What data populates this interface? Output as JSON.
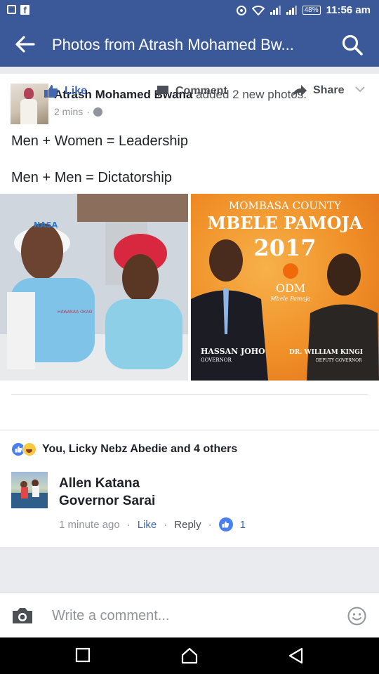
{
  "status_bar": {
    "battery": "48%",
    "time": "11:56 am"
  },
  "app_bar": {
    "title": "Photos from Atrash Mohamed Bw..."
  },
  "post": {
    "author": "Atrash Mohamed Bwana",
    "action_text": "added 2 new photos.",
    "timestamp": "2 mins",
    "text_line_1": "Men + Women = Leadership",
    "text_line_2": "Men + Men = Dictatorship",
    "photo_left": {
      "cap_text": "NASA",
      "shirt_text": "HAWAKAA OKAO"
    },
    "photo_right": {
      "county": "MOMBASA COUNTY",
      "slogan": "MBELE PAMOJA",
      "year": "2017",
      "party": "ODM",
      "party_slogan": "Mbele Pamoja",
      "candidate_1_name": "HASSAN JOHO",
      "candidate_1_role": "GOVERNOR",
      "candidate_2_name": "DR. WILLIAM KINGI",
      "candidate_2_role": "DEPUTY GOVERNOR"
    },
    "actions": {
      "like": "Like",
      "comment": "Comment",
      "share": "Share"
    },
    "reactions_text": "You, Licky Nebz Abedie and 4 others"
  },
  "comment": {
    "author": "Allen Katana",
    "text": "Governor Sarai",
    "time": "1 minute ago",
    "like_label": "Like",
    "reply_label": "Reply",
    "like_count": "1"
  },
  "comment_input": {
    "placeholder": "Write a comment..."
  },
  "colors": {
    "brand": "#3b5998",
    "link": "#4267b2",
    "meta": "#90949c"
  }
}
